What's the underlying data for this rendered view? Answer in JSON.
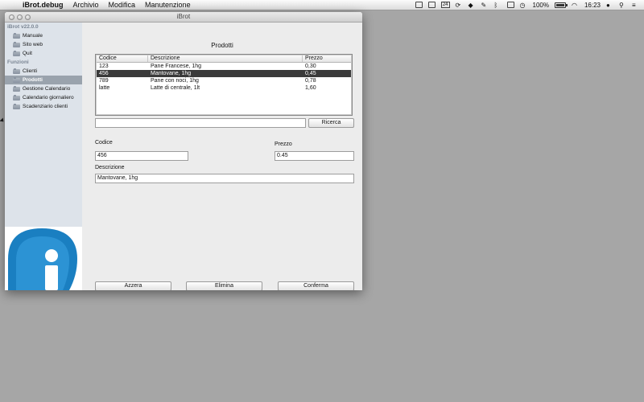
{
  "menubar": {
    "app_name": "iBrot.debug",
    "menus": [
      "Archivio",
      "Modifica",
      "Manutenzione"
    ],
    "status": {
      "calendar_day": "24",
      "battery_text": "100%",
      "time": "16:23"
    }
  },
  "window": {
    "title": "iBrot"
  },
  "sidebar": {
    "version_header": "iBrot v22.0.0",
    "group1": [
      {
        "label": "Manuale"
      },
      {
        "label": "Sito web"
      },
      {
        "label": "Quit"
      }
    ],
    "functions_header": "Funzioni",
    "group2": [
      {
        "label": "Clienti"
      },
      {
        "label": "Prodotti"
      },
      {
        "label": "Gestione Calendario"
      },
      {
        "label": "Calendario giornaliero"
      },
      {
        "label": "Scadenziario clienti"
      }
    ],
    "selected": "Prodotti"
  },
  "products": {
    "title": "Prodotti",
    "columns": [
      "Codice",
      "Descrizione",
      "Prezzo"
    ],
    "rows": [
      [
        "123",
        "Pane Francese, 1hg",
        "0,30"
      ],
      [
        "456",
        "Mantovane, 1hg",
        "0,45"
      ],
      [
        "789",
        "Pane con noci, 1hg",
        "0,78"
      ],
      [
        "latte",
        "Latte di centrale, 1lt",
        "1,60"
      ]
    ],
    "selected_row": 1,
    "search_value": "",
    "search_button": "Ricerca"
  },
  "form": {
    "codice_label": "Codice",
    "codice_value": "456",
    "prezzo_label": "Prezzo",
    "prezzo_value": "0.45",
    "descrizione_label": "Descrizione",
    "descrizione_value": "Mantovane, 1hg"
  },
  "buttons": {
    "reset": "Azzera",
    "delete": "Elimina",
    "confirm": "Conferma"
  },
  "colors": {
    "logo_blue": "#1a7fc1",
    "selection_dark": "#3a3a3a",
    "sidebar_bg": "#dde3ea"
  }
}
